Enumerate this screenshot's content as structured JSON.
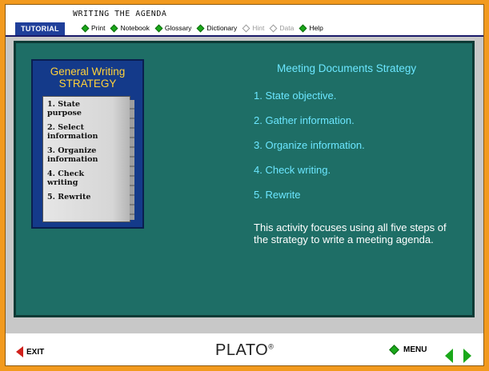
{
  "header": {
    "badge": "TUTORIAL",
    "heading": "WRITING THE AGENDA",
    "tools": [
      {
        "label": "Print",
        "enabled": true,
        "icon": "green-diamond-icon"
      },
      {
        "label": "Notebook",
        "enabled": true,
        "icon": "green-diamond-icon"
      },
      {
        "label": "Glossary",
        "enabled": true,
        "icon": "green-diamond-icon"
      },
      {
        "label": "Dictionary",
        "enabled": true,
        "icon": "green-diamond-icon"
      },
      {
        "label": "Hint",
        "enabled": false,
        "icon": "outline-diamond-icon"
      },
      {
        "label": "Data",
        "enabled": false,
        "icon": "outline-diamond-icon"
      },
      {
        "label": "Help",
        "enabled": true,
        "icon": "green-diamond-icon"
      }
    ]
  },
  "book": {
    "title_line1": "General Writing",
    "title_line2": "STRATEGY",
    "steps": [
      "1. State\n   purpose",
      "2. Select\n   information",
      "3. Organize\n   information",
      "4. Check\n   writing",
      "5. Rewrite"
    ]
  },
  "strategy": {
    "heading": "Meeting Documents Strategy",
    "items": [
      "1.  State objective.",
      "2.  Gather information.",
      "3.  Organize information.",
      "4.  Check writing.",
      "5.  Rewrite"
    ],
    "description": "This activity focuses using all five steps of the strategy to write a meeting agenda."
  },
  "footer": {
    "exit_label": "EXIT",
    "brand": "PLATO",
    "brand_mark": "®",
    "menu_label": "MENU"
  },
  "colors": {
    "frame": "#f29a1e",
    "panel": "#1e6e66",
    "accent_text": "#6be6ff",
    "book": "#143a8a",
    "book_title": "#ffd23a",
    "nav_green": "#1aa81a",
    "exit_red": "#d0211c"
  }
}
